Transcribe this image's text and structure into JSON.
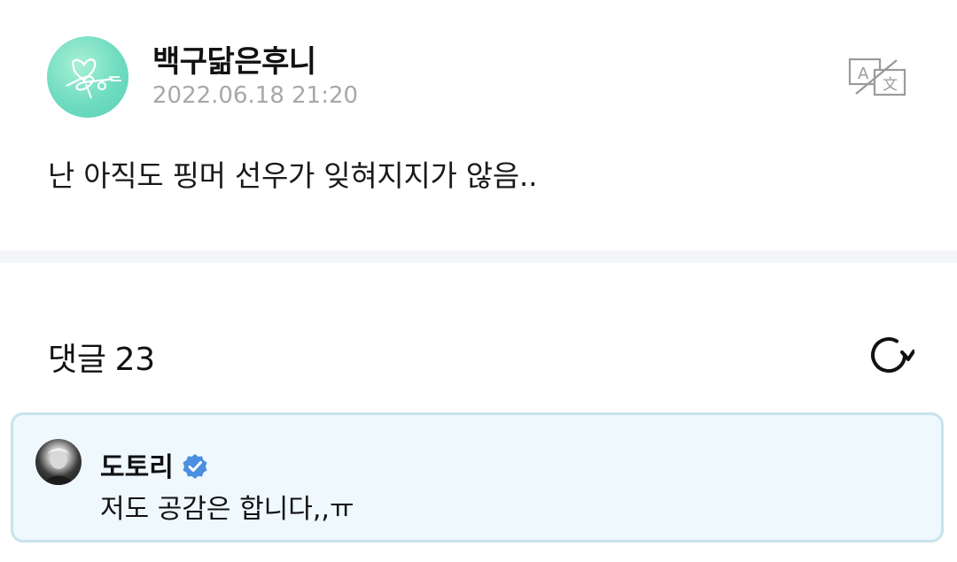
{
  "post": {
    "author": "백구닮은후니",
    "timestamp": "2022.06.18 21:20",
    "body": "난 아직도 핑머 선우가 잊혀지지가 않음..",
    "translate_icon": "translate-icon"
  },
  "comments": {
    "title": "댓글",
    "count": "23",
    "refresh_icon": "refresh-icon",
    "items": [
      {
        "author": "도토리",
        "verified": true,
        "text": "저도 공감은 합니다,,ㅠ"
      }
    ]
  },
  "colors": {
    "timestamp": "#a8a8a8",
    "verified_badge": "#4a8fe0",
    "comment_bg": "#eef8fd",
    "comment_border": "#c8e3ee",
    "divider": "#f3f5f8"
  }
}
